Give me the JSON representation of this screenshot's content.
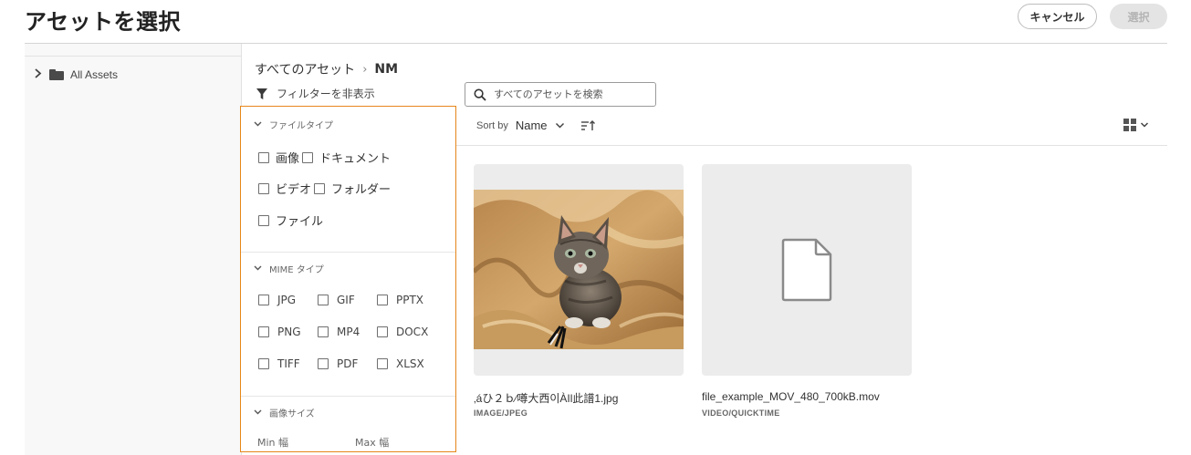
{
  "header": {
    "title": "アセットを選択",
    "cancel_label": "キャンセル",
    "select_label": "選択"
  },
  "sidebar": {
    "items": [
      {
        "label": "All Assets",
        "icon": "folder-icon",
        "expander": "chevron-right-icon"
      }
    ]
  },
  "breadcrumb": {
    "root": "すべてのアセット",
    "separator": "›",
    "current": "NM"
  },
  "filter_toggle": {
    "label": "フィルターを非表示",
    "icon": "funnel-icon"
  },
  "search": {
    "placeholder": "すべてのアセットを検索",
    "value": "",
    "icon": "search-icon"
  },
  "filters": {
    "file_type": {
      "title": "ファイルタイプ",
      "options": [
        {
          "label": "画像",
          "checked": false
        },
        {
          "label": "ドキュメント",
          "checked": false
        },
        {
          "label": "ビデオ",
          "checked": false
        },
        {
          "label": "フォルダー",
          "checked": false
        },
        {
          "label": "ファイル",
          "checked": false
        }
      ]
    },
    "mime_type": {
      "title": "MIME タイプ",
      "options": [
        {
          "label": "JPG",
          "checked": false
        },
        {
          "label": "GIF",
          "checked": false
        },
        {
          "label": "PPTX",
          "checked": false
        },
        {
          "label": "PNG",
          "checked": false
        },
        {
          "label": "MP4",
          "checked": false
        },
        {
          "label": "DOCX",
          "checked": false
        },
        {
          "label": "TIFF",
          "checked": false
        },
        {
          "label": "PDF",
          "checked": false
        },
        {
          "label": "XLSX",
          "checked": false
        }
      ]
    },
    "image_size": {
      "title": "画像サイズ",
      "min_label": "Min 幅",
      "max_label": "Max 幅"
    }
  },
  "sort": {
    "label": "Sort by",
    "value": "Name",
    "order_icon": "sort-ascending-icon"
  },
  "view": {
    "icon": "grid-view-icon"
  },
  "assets": [
    {
      "name": "‚áひ２ｂ⁄噂大西이ÀIl此譜1.jpg",
      "type": "IMAGE/JPEG",
      "thumbnail": "kitten-photo"
    },
    {
      "name": "file_example_MOV_480_700kB.mov",
      "type": "VIDEO/QUICKTIME",
      "thumbnail": "file-icon"
    }
  ],
  "colors": {
    "accent_border": "#e68619",
    "disabled_button": "#e4e4e4",
    "card_background": "#ececec"
  }
}
